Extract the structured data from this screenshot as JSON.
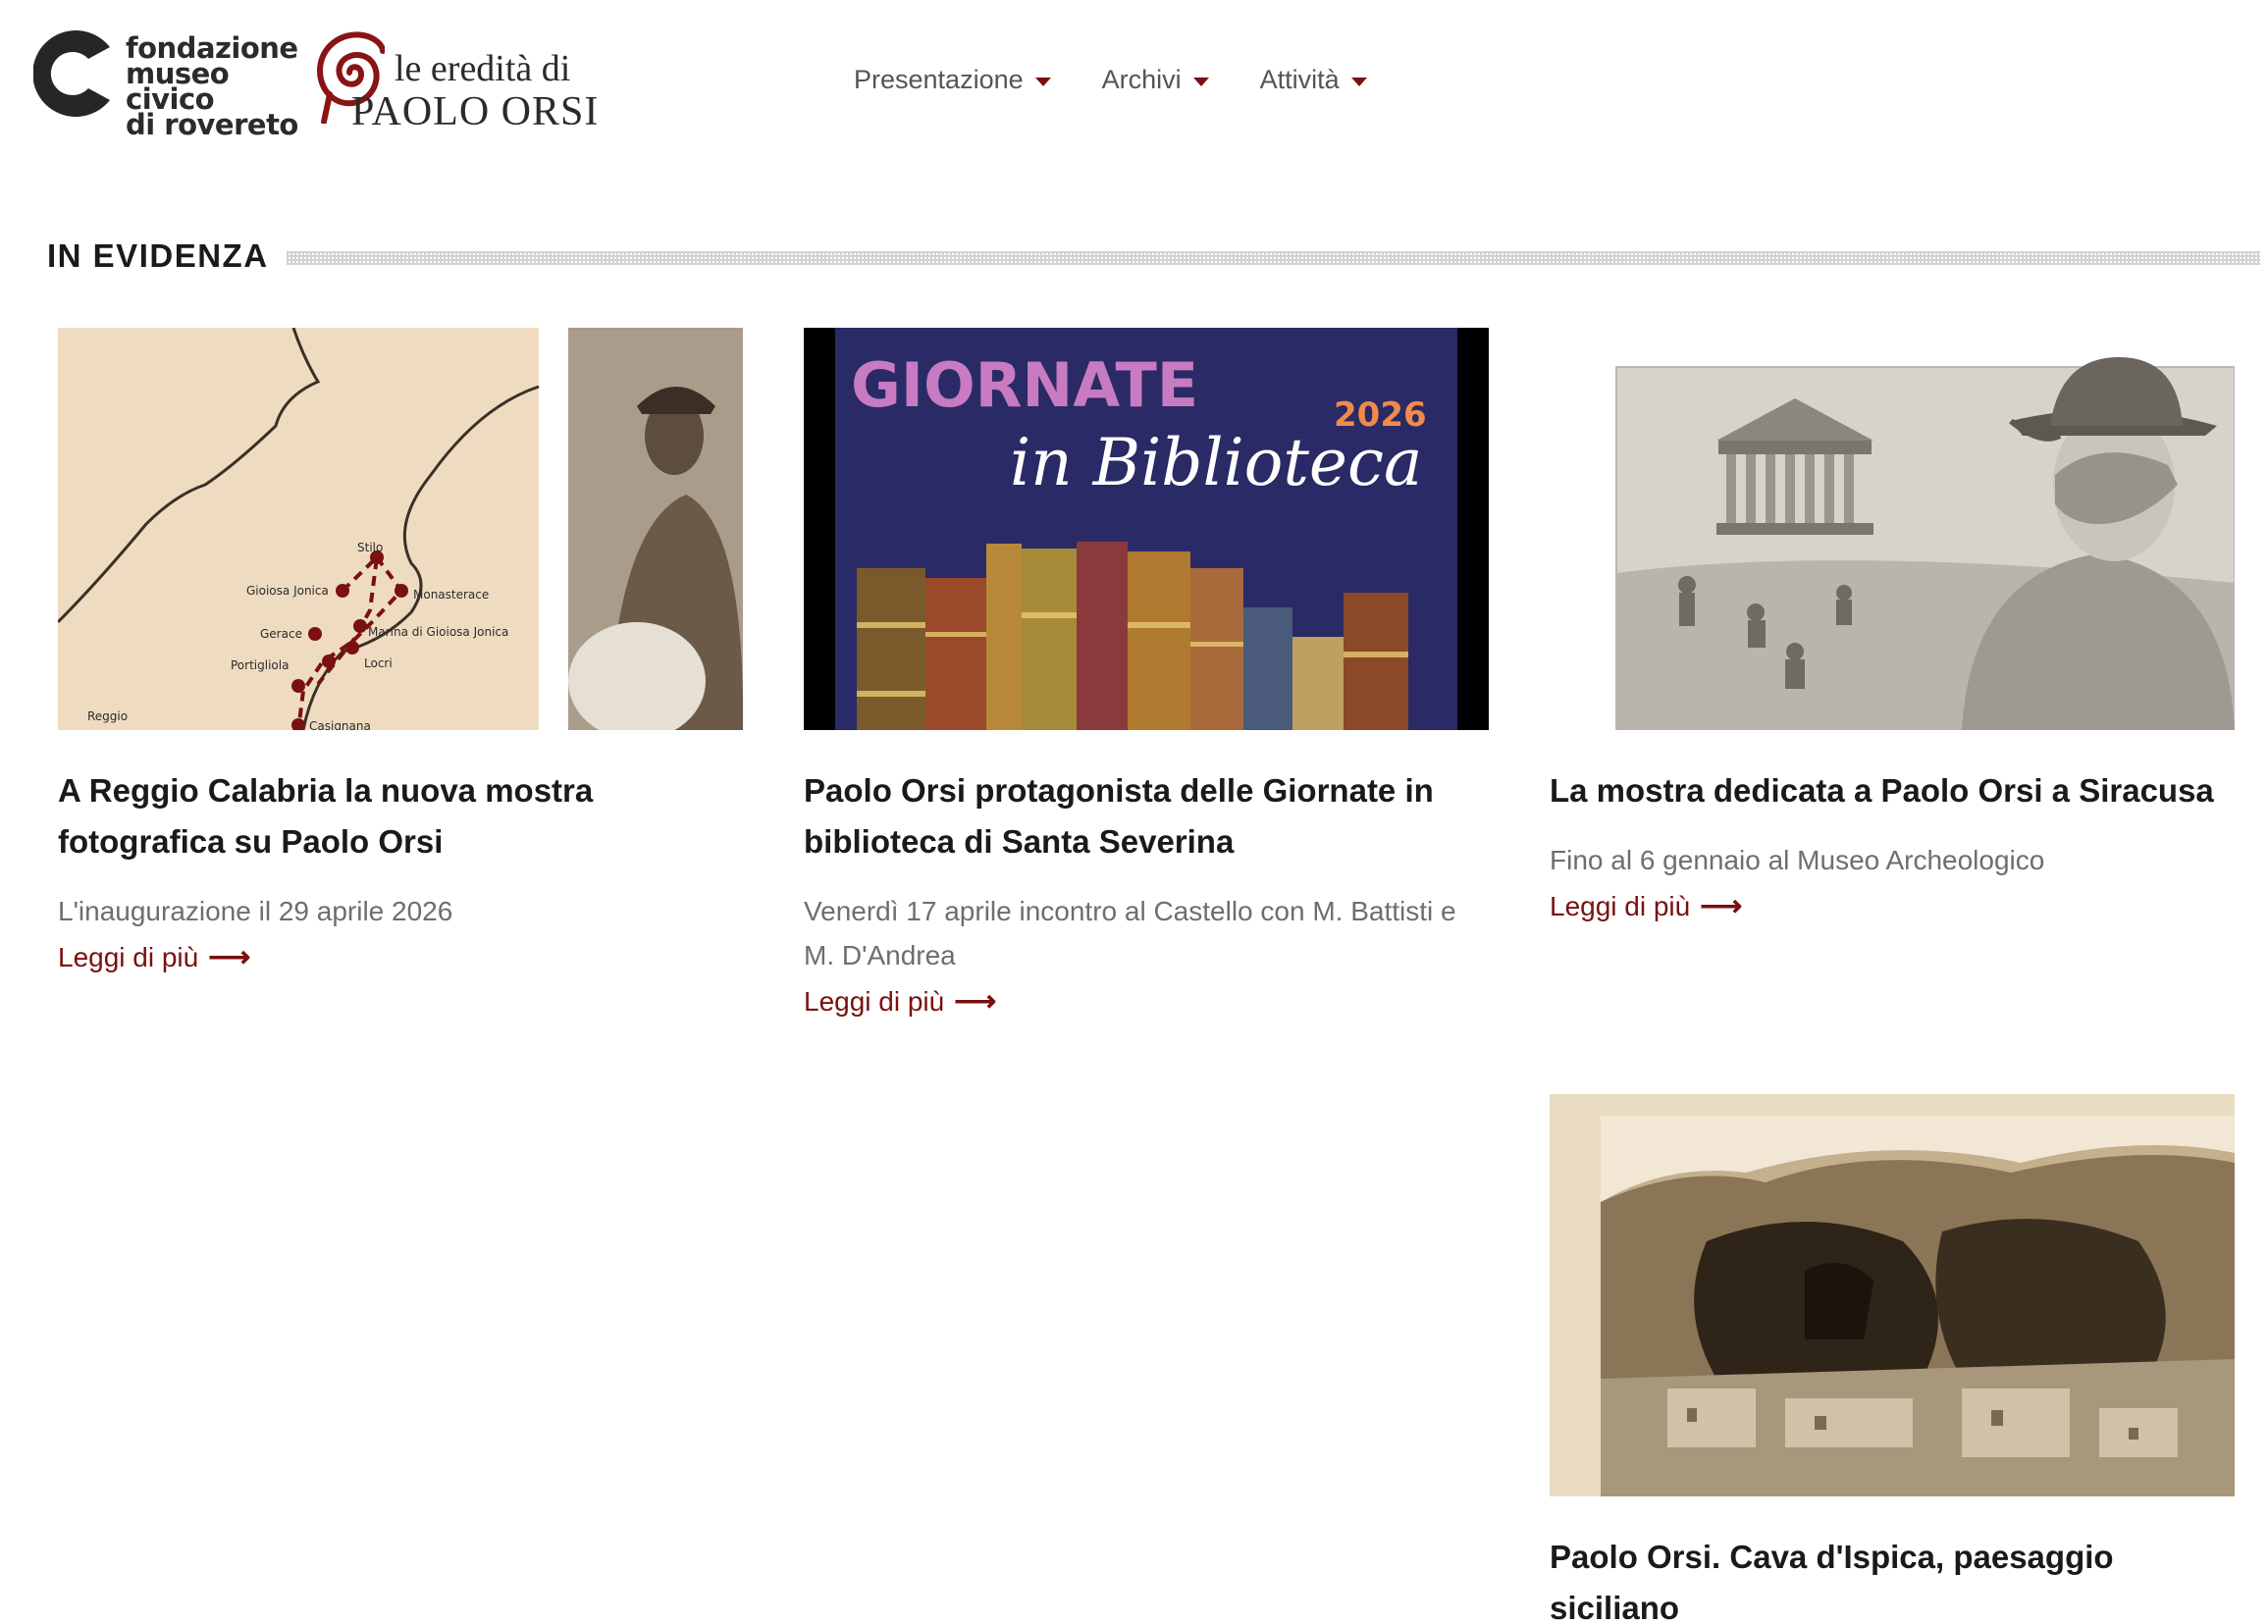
{
  "logos": {
    "fondazione": [
      "fondazione",
      "museo civico",
      "di rovereto"
    ],
    "orsi_top": "le eredità di",
    "orsi_bottom": "PAOLO ORSI"
  },
  "nav": [
    {
      "label": "Presentazione"
    },
    {
      "label": "Archivi"
    },
    {
      "label": "Attività"
    }
  ],
  "section": {
    "title": "IN EVIDENZA"
  },
  "cards": [
    {
      "title": "A Reggio Calabria la nuova mostra fotografica su Paolo Orsi",
      "subtitle": "L'inaugurazione il 29 aprile 2026",
      "more": "Leggi di più",
      "map_labels": [
        "Stilo",
        "Gioiosa Jonica",
        "Monasterace",
        "Gerace",
        "Marina di Gioiosa Jonica",
        "Portigliola",
        "Locri",
        "Reggio",
        "Casignana"
      ]
    },
    {
      "title": "Paolo Orsi protagonista delle Giornate in biblioteca di Santa Severina",
      "subtitle": "Venerdì 17 aprile incontro al Castello con M. Battisti e M. D'Andrea",
      "more": "Leggi di più",
      "poster_line1": "GIORNATE",
      "poster_line2": "in Biblioteca",
      "poster_year": "2026"
    },
    {
      "title": "La mostra dedicata a Paolo Orsi a Siracusa",
      "subtitle": "Fino al 6 gennaio al Museo Archeologico",
      "more": "Leggi di più"
    },
    {
      "title": "Paolo Orsi. Cava d'Ispica, paesaggio siciliano",
      "subtitle": "",
      "more": ""
    }
  ],
  "colors": {
    "accent": "#7a1010",
    "nav_text": "#555555",
    "muted": "#6e6e6e",
    "poster_bg": "#2a2a66"
  }
}
